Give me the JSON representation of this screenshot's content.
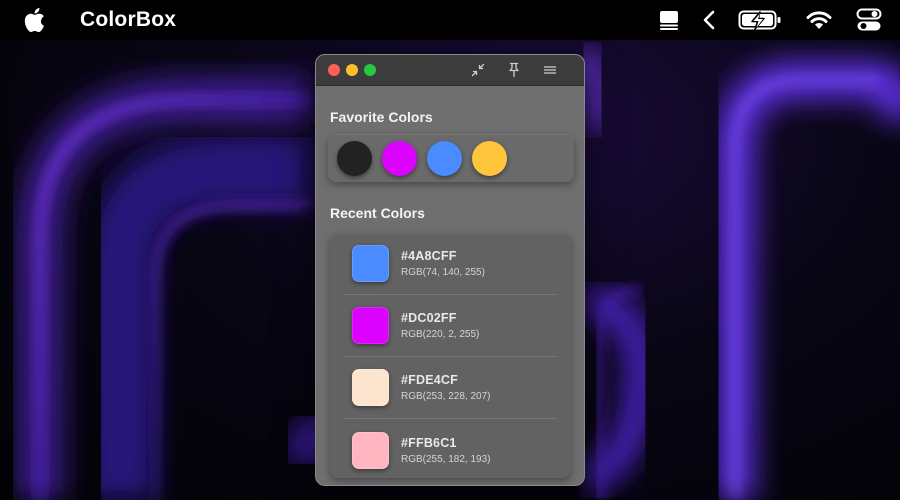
{
  "menubar": {
    "app_name": "ColorBox",
    "icons": [
      "apple-logo",
      "stack-icon",
      "chevron-left-icon",
      "battery-charging-icon",
      "wifi-icon",
      "control-center-icon"
    ]
  },
  "window": {
    "toolbar_icons": [
      "collapse-icon",
      "pin-icon",
      "menu-icon"
    ],
    "favorites": {
      "title": "Favorite Colors",
      "colors": [
        "#222222",
        "#DC02FF",
        "#4A8CFF",
        "#FFC53D"
      ]
    },
    "recent": {
      "title": "Recent Colors",
      "items": [
        {
          "hex": "#4A8CFF",
          "rgb": "RGB(74, 140, 255)",
          "color": "#4A8CFF"
        },
        {
          "hex": "#DC02FF",
          "rgb": "RGB(220, 2, 255)",
          "color": "#DC02FF"
        },
        {
          "hex": "#FDE4CF",
          "rgb": "RGB(253, 228, 207)",
          "color": "#FDE4CF"
        },
        {
          "hex": "#FFB6C1",
          "rgb": "RGB(255, 182, 193)",
          "color": "#FFB6C1"
        }
      ]
    }
  }
}
